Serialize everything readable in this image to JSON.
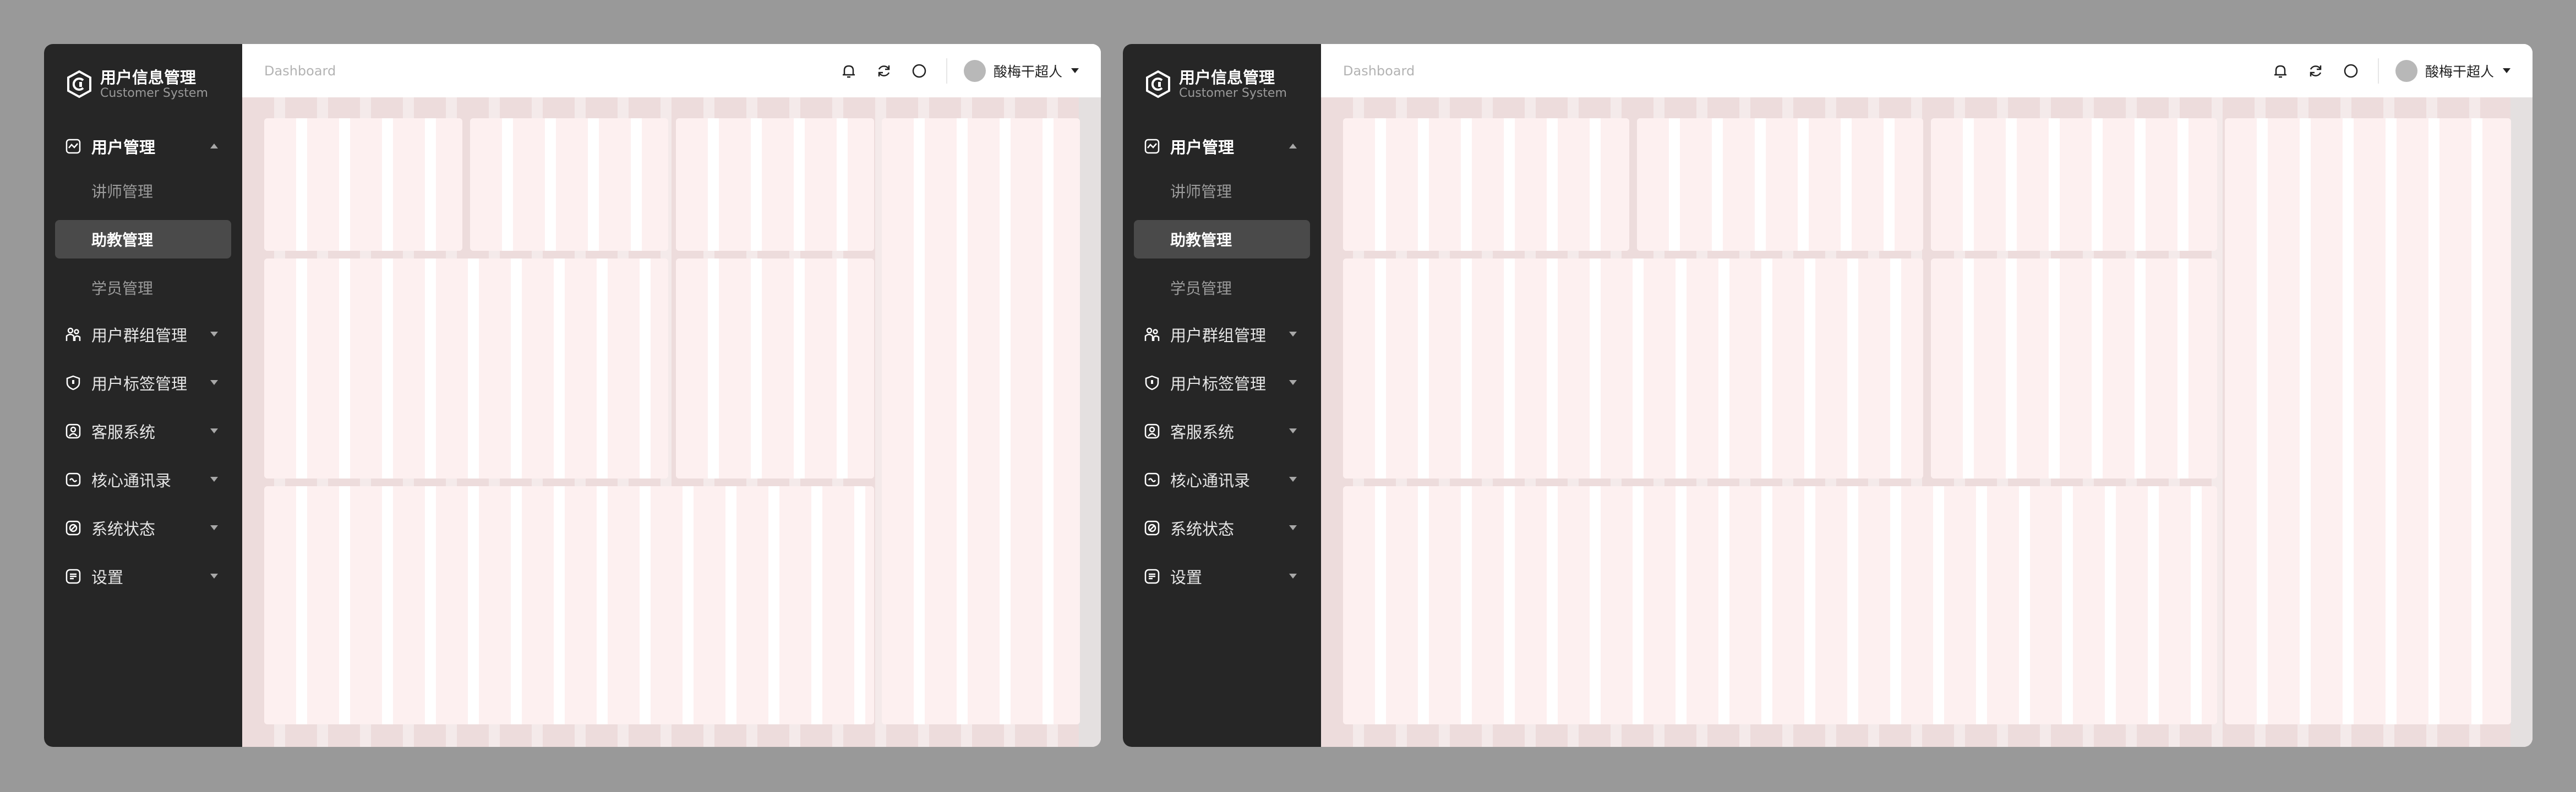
{
  "windows": [
    {
      "id": "a",
      "brand": {
        "title": "用户信息管理",
        "subtitle": "Customer System"
      },
      "breadcrumb": "Dashboard",
      "user": {
        "name": "酸梅干超人"
      }
    },
    {
      "id": "b",
      "brand": {
        "title": "用户信息管理",
        "subtitle": "Customer System"
      },
      "breadcrumb": "Dashboard",
      "user": {
        "name": "酸梅干超人"
      }
    }
  ],
  "menu": {
    "groups": [
      {
        "label": "用户管理",
        "icon": "chart-icon",
        "expanded": true
      },
      {
        "label": "用户群组管理",
        "icon": "group-icon"
      },
      {
        "label": "用户标签管理",
        "icon": "tag-shield-icon"
      },
      {
        "label": "客服系统",
        "icon": "user-card-icon"
      },
      {
        "label": "核心通讯录",
        "icon": "contacts-icon"
      },
      {
        "label": "系统状态",
        "icon": "status-icon"
      },
      {
        "label": "设置",
        "icon": "settings-icon"
      }
    ],
    "sub": [
      {
        "label": "讲师管理"
      },
      {
        "label": "助教管理",
        "active": true
      },
      {
        "label": "学员管理"
      }
    ]
  },
  "colors": {
    "sidebar": "#262626",
    "sub_active": "#4a4a4a",
    "card": "#fdf0f0",
    "desktop": "#999999"
  }
}
